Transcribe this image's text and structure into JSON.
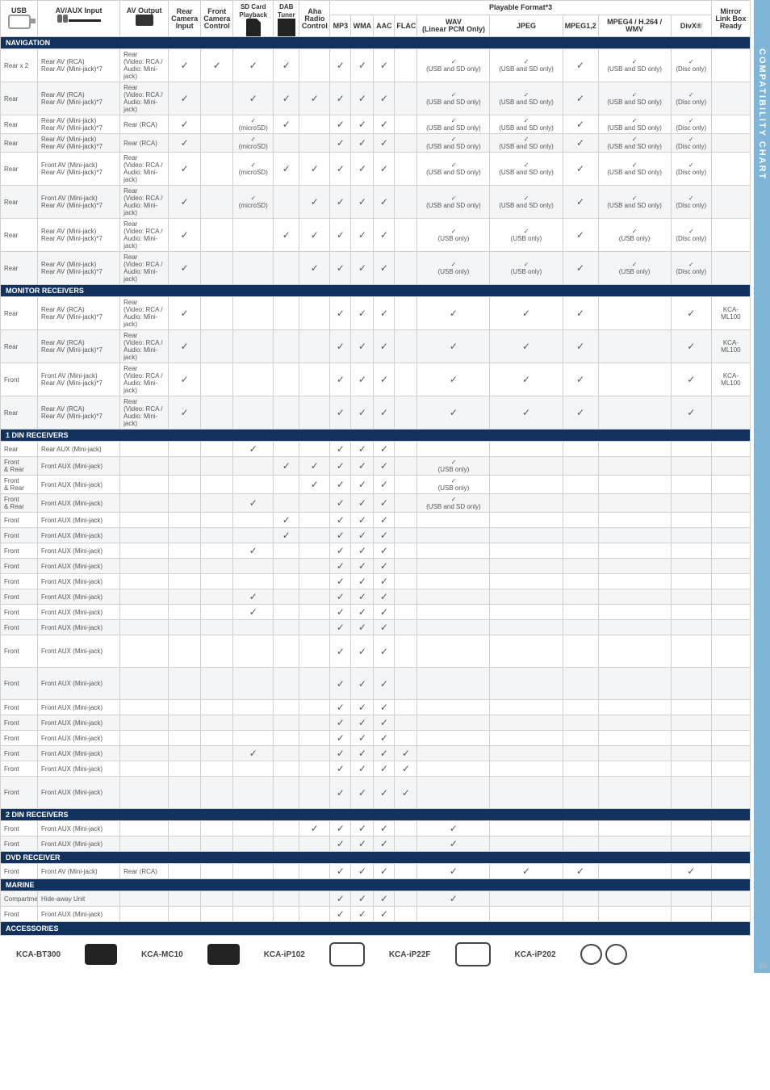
{
  "sidebar_label": "COMPATIBILITY CHART",
  "page_number": "35",
  "headers": {
    "usb": "USB",
    "avaux": "AV/AUX Input",
    "avout": "AV Output",
    "rcam": "Rear\nCamera\nInput",
    "fcam": "Front\nCamera\nControl",
    "sd": "SD Card\nPlayback",
    "dab": "DAB\nTuner",
    "aha": "Aha\nRadio\nControl",
    "playable": "Playable Format*3",
    "mirror": "Mirror\nLink Box\nReady",
    "mp3": "MP3",
    "wma": "WMA",
    "aac": "AAC",
    "flac": "FLAC",
    "wav": "WAV\n(Linear PCM Only)",
    "jpeg": "JPEG",
    "mpeg": "MPEG1,2",
    "mpeg4": "MPEG4 / H.264 /\nWMV",
    "divx": "DivX®"
  },
  "ck": "✓",
  "sections": {
    "navigation": "NAVIGATION",
    "monitor": "MONITOR RECEIVERS",
    "onedin": "1 DIN RECEIVERS",
    "twodin": "2 DIN RECEIVERS",
    "dvd": "DVD RECEIVER",
    "marine": "MARINE",
    "accessories": "ACCESSORIES"
  },
  "cells": {
    "rear": "Rear",
    "rearx2": "Rear x 2",
    "front": "Front",
    "frontrear": "Front\n& Rear",
    "comp": "Compartment",
    "rav_rca": "Rear AV (RCA)\nRear AV (Mini-jack)*7",
    "rav_mini": "Rear AV (Mini-jack)\nRear AV (Mini-jack)*7",
    "fav_mini": "Front AV (Mini-jack)\nRear AV (Mini-jack)*7",
    "rear_aux": "Rear AUX (Mini-jack)",
    "front_aux": "Front AUX (Mini-jack)",
    "front_av": "Front AV (Mini-jack)",
    "hide": "Hide-away Unit",
    "avo_rear": "Rear\n(Video: RCA /\nAudio: Mini-jack)",
    "avo_rca": "Rear (RCA)",
    "microsd": "✓\n(microSD)",
    "usbsd": "✓\n(USB and SD only)",
    "usb": "✓\n(USB only)",
    "disc": "✓\n(Disc only)",
    "kca": "KCA-ML100"
  },
  "footer": {
    "a": "KCA-BT300",
    "b": "KCA-MC10",
    "c": "KCA-iP102",
    "d": "KCA-iP22F",
    "e": "KCA-iP202"
  }
}
